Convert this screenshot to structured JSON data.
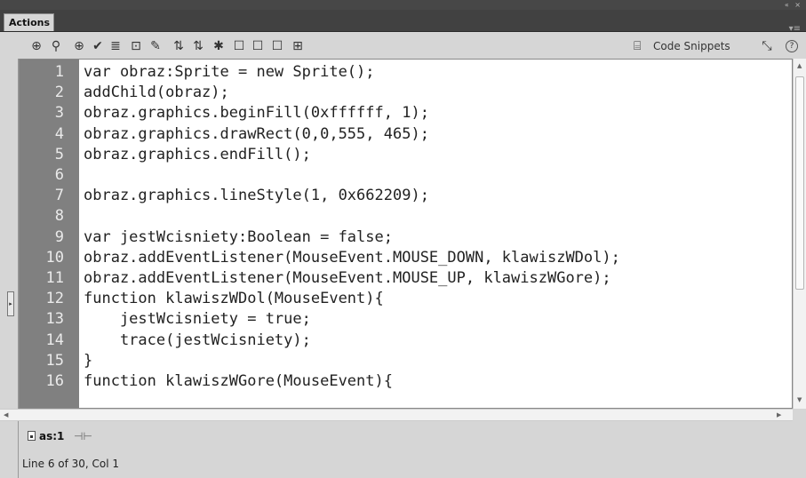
{
  "panel": {
    "title": "Actions",
    "top_controls": "« ×",
    "menu_glyph": "▾≡"
  },
  "toolbar": {
    "icons": [
      "add-statement-icon",
      "find-icon",
      "insert-target-path-icon",
      "check-syntax-icon",
      "auto-format-icon",
      "show-code-hint-icon",
      "debug-options-icon",
      "collapse-between-braces-icon",
      "collapse-selection-icon",
      "expand-all-icon",
      "apply-block-comment-icon",
      "apply-line-comment-icon",
      "remove-comment-icon",
      "show-hide-toolbox-icon"
    ],
    "glyphs": [
      "⊕",
      "⚲",
      "⊕",
      "✔",
      "≣",
      "⊡",
      "✎",
      "⇅",
      "⇅",
      "✱",
      "☐",
      "☐",
      "☐",
      "⊞"
    ],
    "snippets_label": "Code Snippets",
    "snippets_glyph": "⌸",
    "wand_glyph": "⤡",
    "help_glyph": "?"
  },
  "code": {
    "lines": [
      {
        "n": "1",
        "t": "var obraz:Sprite = new Sprite();"
      },
      {
        "n": "2",
        "t": "addChild(obraz);"
      },
      {
        "n": "3",
        "t": "obraz.graphics.beginFill(0xffffff, 1);"
      },
      {
        "n": "4",
        "t": "obraz.graphics.drawRect(0,0,555, 465);"
      },
      {
        "n": "5",
        "t": "obraz.graphics.endFill();"
      },
      {
        "n": "6",
        "t": ""
      },
      {
        "n": "7",
        "t": "obraz.graphics.lineStyle(1, 0x662209);"
      },
      {
        "n": "8",
        "t": ""
      },
      {
        "n": "9",
        "t": "var jestWcisniety:Boolean = false;"
      },
      {
        "n": "10",
        "t": "obraz.addEventListener(MouseEvent.MOUSE_DOWN, klawiszWDol);"
      },
      {
        "n": "11",
        "t": "obraz.addEventListener(MouseEvent.MOUSE_UP, klawiszWGore);"
      },
      {
        "n": "12",
        "t": "function klawiszWDol(MouseEvent){"
      },
      {
        "n": "13",
        "t": "    jestWcisniety = true;"
      },
      {
        "n": "14",
        "t": "    trace(jestWcisniety);"
      },
      {
        "n": "15",
        "t": "}"
      },
      {
        "n": "16",
        "t": "function klawiszWGore(MouseEvent){"
      }
    ]
  },
  "file_tab": {
    "label": "as:1"
  },
  "status": {
    "text": "Line 6 of 30, Col 1"
  }
}
